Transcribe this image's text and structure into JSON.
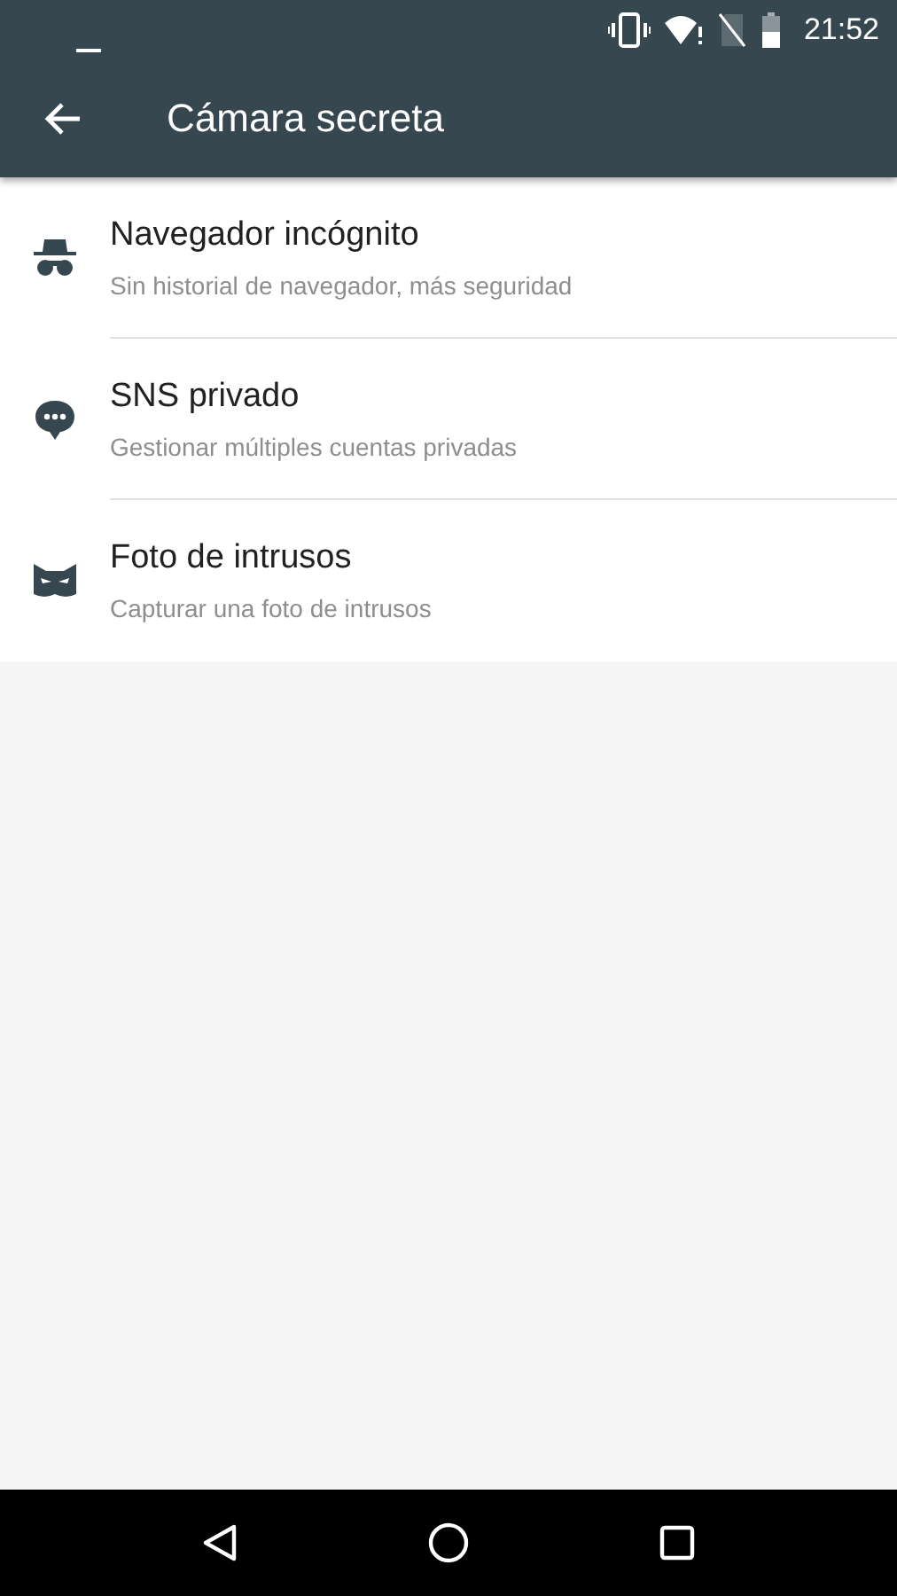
{
  "status_bar": {
    "time": "21:52"
  },
  "toolbar": {
    "title": "Cámara secreta"
  },
  "items": [
    {
      "kind": "incognito",
      "title": "Navegador incógnito",
      "subtitle": "Sin historial de navegador, más seguridad"
    },
    {
      "kind": "chat",
      "title": "SNS privado",
      "subtitle": "Gestionar múltiples cuentas privadas"
    },
    {
      "kind": "mask",
      "title": "Foto de intrusos",
      "subtitle": "Capturar una foto de intrusos"
    }
  ]
}
